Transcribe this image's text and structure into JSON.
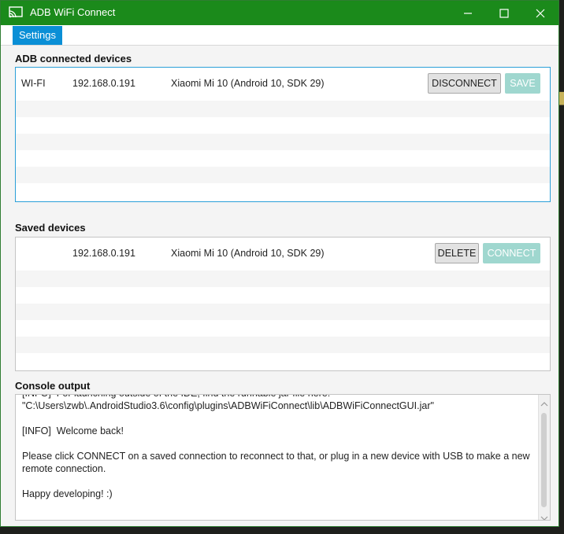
{
  "window": {
    "title": "ADB WiFi Connect"
  },
  "menu": {
    "settings_label": "Settings"
  },
  "connected": {
    "section_label": "ADB connected devices",
    "rows": [
      {
        "type": "WI-FI",
        "ip": "192.168.0.191",
        "device": "Xiaomi Mi 10 (Android 10, SDK 29)",
        "primary_button": "DISCONNECT",
        "secondary_button": "SAVE"
      }
    ],
    "empty_rows": 6
  },
  "saved": {
    "section_label": "Saved devices",
    "rows": [
      {
        "type": "",
        "ip": "192.168.0.191",
        "device": "Xiaomi Mi 10 (Android 10, SDK 29)",
        "primary_button": "DELETE",
        "secondary_button": "CONNECT"
      }
    ],
    "empty_rows": 6
  },
  "console": {
    "section_label": "Console output",
    "lines": "[INFO]  For launching outside of the IDE, find the runnable jar file here:\n\"C:\\Users\\zwb\\.AndroidStudio3.6\\config\\plugins\\ADBWiFiConnect\\lib\\ADBWiFiConnectGUI.jar\"\n\n[INFO]  Welcome back!\n\nPlease click CONNECT on a saved connection to reconnect to that, or plug in a new device with USB to make a new remote connection.\n\nHappy developing! :)"
  },
  "icons": {
    "app": "cast-icon",
    "minimize": "minimize-icon",
    "maximize": "maximize-icon",
    "close": "close-icon"
  },
  "colors": {
    "titlebar": "#1b8a1b",
    "menu_active": "#0a8fd6",
    "disabled_button": "#9fd7cf",
    "focus_border": "#2a9fd8"
  }
}
